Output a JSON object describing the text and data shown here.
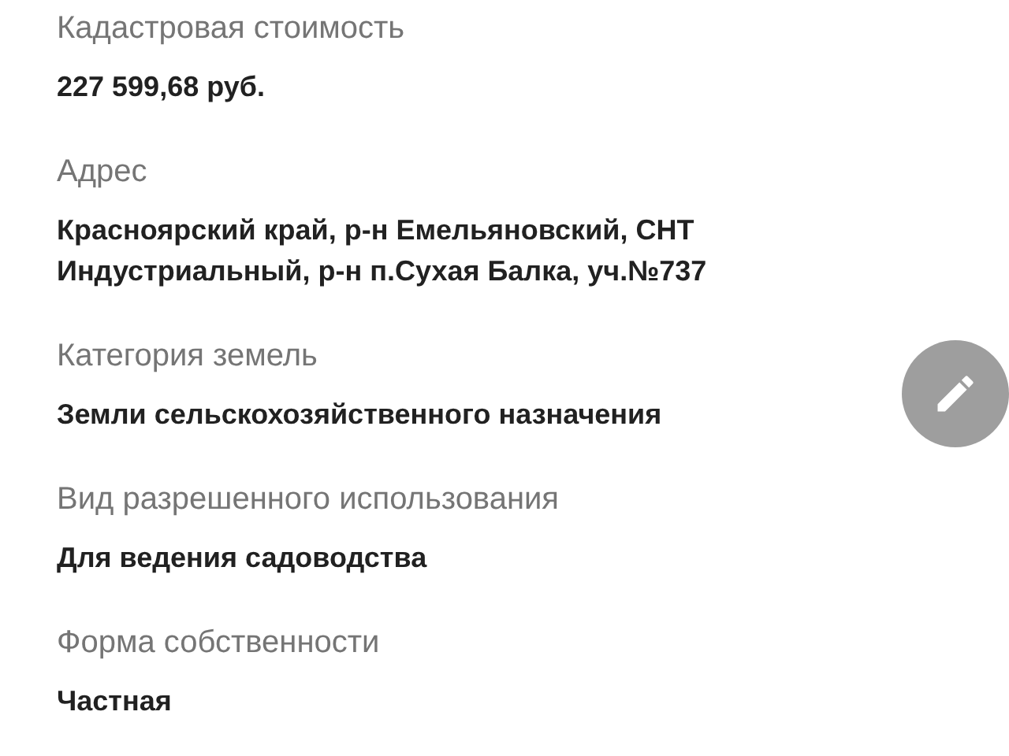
{
  "fields": [
    {
      "label": "Кадастровая стоимость",
      "value": "227 599,68 руб."
    },
    {
      "label": "Адрес",
      "value": "Красноярский край, р-н Емельяновский, СНТ Индустриальный, р-н п.Сухая Балка, уч.№737"
    },
    {
      "label": "Категория земель",
      "value": "Земли сельскохозяйственного назначения"
    },
    {
      "label": "Вид разрешенного использования",
      "value": "Для ведения садоводства"
    },
    {
      "label": "Форма собственности",
      "value": "Частная"
    }
  ]
}
